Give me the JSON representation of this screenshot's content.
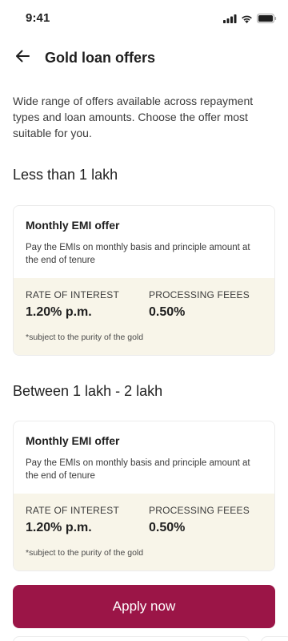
{
  "status_bar": {
    "time": "9:41",
    "icons": [
      "signal-icon",
      "wifi-icon",
      "battery-icon"
    ]
  },
  "header": {
    "back_icon": "arrow-left-icon",
    "title": "Gold loan offers"
  },
  "intro": "Wide range of offers available across repayment types and loan amounts. Choose the offer most suitable for you.",
  "sections": [
    {
      "title": "Less than 1 lakh",
      "offer": {
        "title": "Monthly EMI offer",
        "description": "Pay the EMIs on monthly basis and principle amount at the end of tenure",
        "rate_label": "Rate of interest",
        "rate_value": "1.20% p.m.",
        "fee_label": "Processing feees",
        "fee_value": "0.50%",
        "note": "*subject to the purity of the gold"
      }
    },
    {
      "title": "Between 1 lakh - 2 lakh",
      "offer": {
        "title": "Monthly EMI offer",
        "description": "Pay the EMIs on monthly basis and principle amount at the end of tenure",
        "rate_label": "Rate of interest",
        "rate_value": "1.20% p.m.",
        "fee_label": "Processing feees",
        "fee_value": "0.50%",
        "note": "*subject to the purity of the gold"
      }
    }
  ],
  "cta": {
    "label": "Apply now"
  },
  "colors": {
    "primary": "#9b1547",
    "card_footer": "#f8f5e9",
    "border": "#ececec"
  }
}
